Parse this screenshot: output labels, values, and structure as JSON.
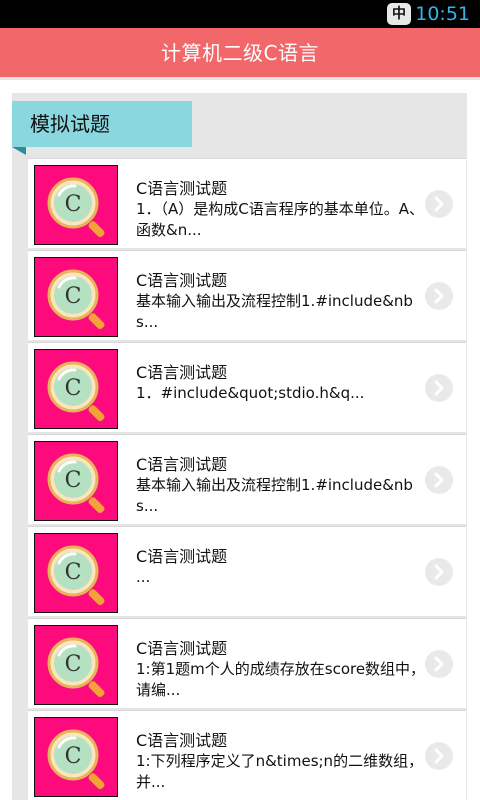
{
  "statusbar": {
    "ime": "中",
    "time": "10:51"
  },
  "app": {
    "title": "计算机二级C语言"
  },
  "section": {
    "title": "模拟试题"
  },
  "items": [
    {
      "title": "C语言测试题",
      "desc": "1．（A）是构成C语言程序的基本单位。A、函数&n..."
    },
    {
      "title": "C语言测试题",
      "desc": "基本输入输出及流程控制1.#include&nbs..."
    },
    {
      "title": "C语言测试题",
      "desc": "1．#include&quot;stdio.h&q..."
    },
    {
      "title": "C语言测试题",
      "desc": "基本输入输出及流程控制1.#include&nbs..."
    },
    {
      "title": "C语言测试题",
      "desc": "..."
    },
    {
      "title": "C语言测试题",
      "desc": "1:第1题m个人的成绩存放在score数组中，请编..."
    },
    {
      "title": "C语言测试题",
      "desc": "1:下列程序定义了n&times;n的二维数组，并..."
    }
  ],
  "thumb_letter": "C",
  "colors": {
    "title_bar": "#f2686a",
    "tab": "#8ad7df",
    "thumb_bg": "#fd0a7c",
    "clock": "#33b5e5"
  }
}
